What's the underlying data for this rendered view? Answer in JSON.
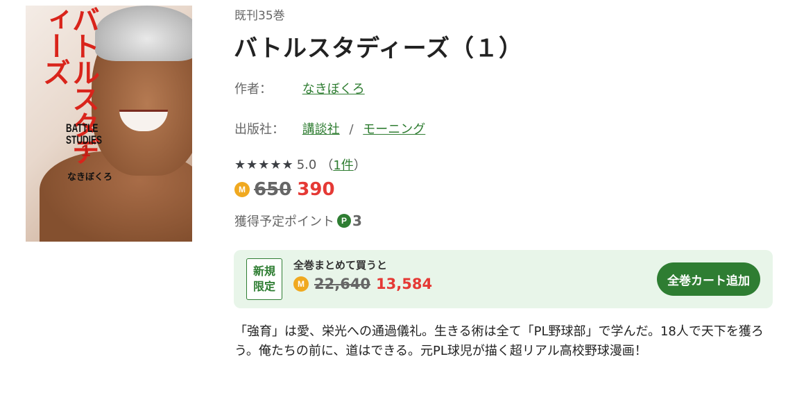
{
  "cover": {
    "title_jp": "バトルスタディーズ",
    "title_en": "BATTLE STUDIES",
    "volume": "1",
    "author": "なきぼくろ"
  },
  "series_count": "既刊35巻",
  "title": "バトルスタディーズ（１）",
  "author": {
    "label": "作者：",
    "name": "なきぼくろ"
  },
  "publisher": {
    "label": "出版社：",
    "name": "講談社",
    "separator": "/",
    "imprint": "モーニング"
  },
  "rating": {
    "stars": "★★★★★",
    "score": "5.0",
    "open": "（",
    "count": "1件",
    "close": "）"
  },
  "price": {
    "icon": "M",
    "original": "650",
    "sale": "390"
  },
  "points": {
    "label": "獲得予定ポイント",
    "icon": "P",
    "value": "3"
  },
  "bundle": {
    "badge_line1": "新規",
    "badge_line2": "限定",
    "label": "全巻まとめて買うと",
    "icon": "M",
    "original": "22,640",
    "sale": "13,584",
    "button": "全巻カート追加"
  },
  "description": "「強育」は愛、栄光への通過儀礼。生きる術は全て「PL野球部」で学んだ。18人で天下を獲ろう。俺たちの前に、道はできる。元PL球児が描く超リアル高校野球漫画！",
  "colors": {
    "accent_green": "#2e7d32",
    "sale_red": "#e53935",
    "coin_orange": "#f0a920",
    "bundle_bg": "#e8f5e9"
  }
}
